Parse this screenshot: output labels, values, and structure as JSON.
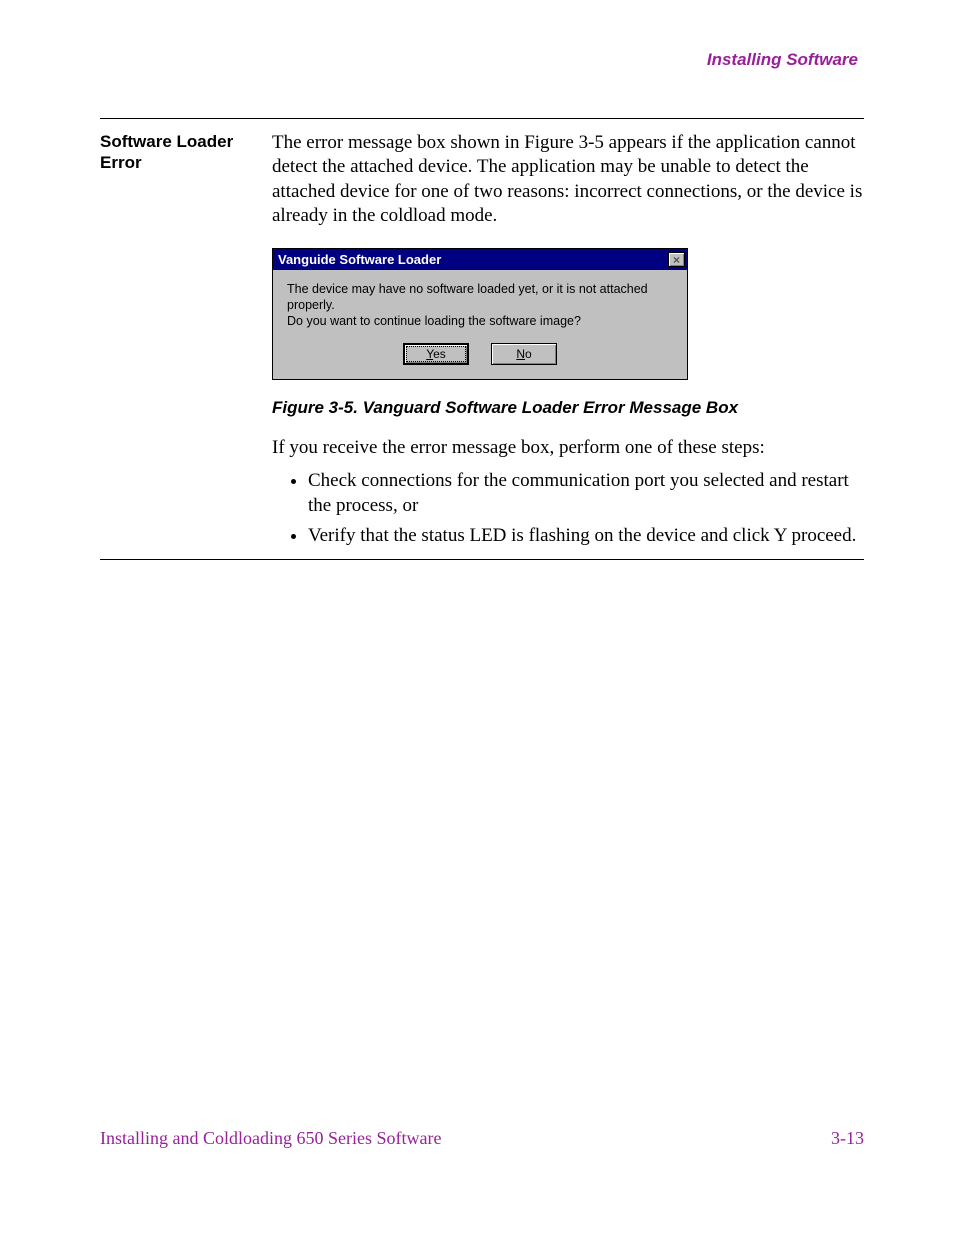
{
  "header": {
    "section_title": "Installing Software"
  },
  "sidebar": {
    "heading": "Software Loader Error"
  },
  "intro_paragraph": "The error message box shown in Figure 3-5 appears if the application cannot detect the attached device. The application may be unable to detect the attached device for one of two reasons: incorrect connections, or the device is already in the coldload mode.",
  "dialog": {
    "title": "Vanguide Software Loader",
    "line1": "The device may have no software loaded yet, or it is not attached properly.",
    "line2": "Do you want to continue loading the software image?",
    "yes_accel": "Y",
    "yes_rest": "es",
    "no_accel": "N",
    "no_rest": "o"
  },
  "figure_caption": "Figure 3-5. Vanguard Software Loader Error Message Box",
  "after_text": "If you receive the error message box, perform one of these steps:",
  "bullets": [
    "Check connections for the communication port you selected and restart the process, or",
    "Verify that the status LED is flashing on the device and click Y proceed."
  ],
  "footer": {
    "left": "Installing and Coldloading 650 Series Software",
    "right": "3-13"
  }
}
